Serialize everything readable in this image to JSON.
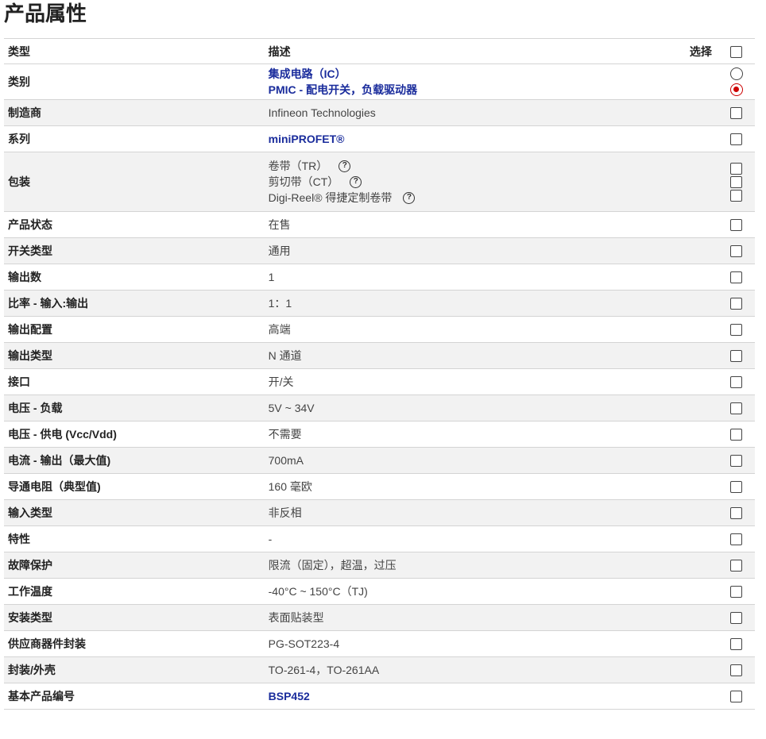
{
  "title": "产品属性",
  "header": {
    "type": "类型",
    "description": "描述",
    "select": "选择"
  },
  "category": {
    "label": "类别",
    "values": [
      "集成电路（IC）",
      "PMIC - 配电开关，负载驱动器"
    ]
  },
  "manufacturer": {
    "label": "制造商",
    "value": "Infineon Technologies"
  },
  "series": {
    "label": "系列",
    "value": "miniPROFET®"
  },
  "packaging": {
    "label": "包装",
    "options": [
      "卷带（TR）",
      "剪切带（CT）",
      "Digi-Reel® 得捷定制卷带"
    ]
  },
  "rows": [
    {
      "label": "产品状态",
      "value": "在售"
    },
    {
      "label": "开关类型",
      "value": "通用"
    },
    {
      "label": "输出数",
      "value": "1"
    },
    {
      "label": "比率 - 输入:输出",
      "value": "1：1"
    },
    {
      "label": "输出配置",
      "value": "高端"
    },
    {
      "label": "输出类型",
      "value": "N 通道"
    },
    {
      "label": "接口",
      "value": "开/关"
    },
    {
      "label": "电压 - 负载",
      "value": "5V ~ 34V"
    },
    {
      "label": "电压 - 供电 (Vcc/Vdd)",
      "value": "不需要"
    },
    {
      "label": "电流 - 输出（最大值)",
      "value": "700mA"
    },
    {
      "label": "导通电阻（典型值)",
      "value": "160 毫欧"
    },
    {
      "label": "输入类型",
      "value": "非反相"
    },
    {
      "label": "特性",
      "value": "-"
    },
    {
      "label": "故障保护",
      "value": "限流（固定），超温，过压"
    },
    {
      "label": "工作温度",
      "value": "-40°C ~ 150°C（TJ)"
    },
    {
      "label": "安装类型",
      "value": "表面贴装型"
    },
    {
      "label": "供应商器件封装",
      "value": "PG-SOT223-4"
    },
    {
      "label": "封装/外壳",
      "value": "TO-261-4，TO-261AA"
    }
  ],
  "base_part": {
    "label": "基本产品编号",
    "value": "BSP452"
  },
  "icons": {
    "help": "help-circle-icon",
    "checkbox": "checkbox-icon",
    "radio": "radio-icon"
  },
  "colors": {
    "link": "#1a2c9c",
    "radio_selected": "#cc0000",
    "row_alt": "#f2f2f2"
  }
}
